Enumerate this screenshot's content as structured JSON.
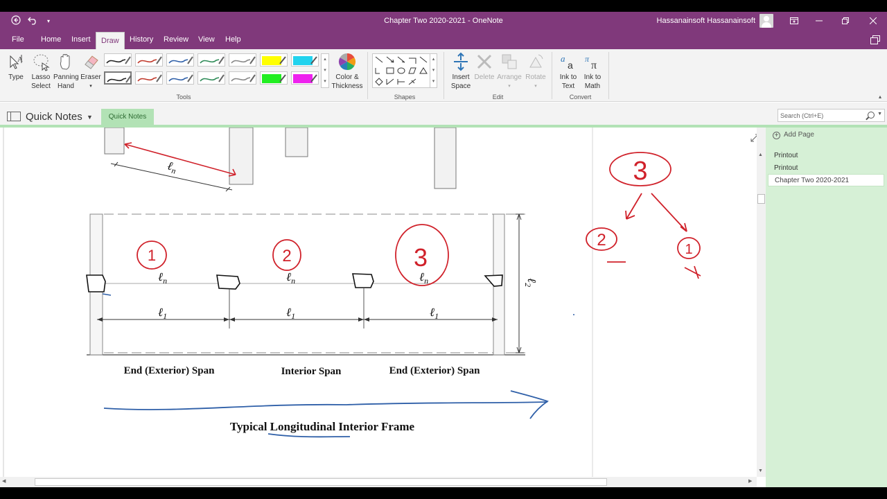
{
  "titlebar": {
    "title": "Chapter Two 2020-2021  -  OneNote",
    "user": "Hassanainsoft Hassanainsoft"
  },
  "menu": [
    "File",
    "Home",
    "Insert",
    "Draw",
    "History",
    "Review",
    "View",
    "Help"
  ],
  "ribbon": {
    "type": "Type",
    "lasso": [
      "Lasso",
      "Select"
    ],
    "panning": [
      "Panning",
      "Hand"
    ],
    "eraser": "Eraser",
    "color": [
      "Color &",
      "Thickness"
    ],
    "insert_space": [
      "Insert",
      "Space"
    ],
    "delete": "Delete",
    "arrange": "Arrange",
    "rotate": "Rotate",
    "ink_text": [
      "Ink to",
      "Text"
    ],
    "ink_math": [
      "Ink to",
      "Math"
    ],
    "groups": {
      "tools": "Tools",
      "shapes": "Shapes",
      "edit": "Edit",
      "convert": "Convert"
    },
    "pen_colors": [
      "#222222",
      "#c0392b",
      "#2e5fa8",
      "#2e8b57",
      "#888888",
      "#ffff00",
      "#22d3ee",
      "#222222",
      "#c0392b",
      "#2e5fa8",
      "#2e8b57",
      "#888888",
      "#22ee22",
      "#ee22ee"
    ]
  },
  "notebook": {
    "name": "Quick Notes",
    "section_tab": "Quick Notes"
  },
  "search": {
    "placeholder": "Search (Ctrl+E)"
  },
  "pages": {
    "add": "Add Page",
    "items": [
      "Printout",
      "Printout",
      "Chapter Two 2020-2021"
    ]
  },
  "drawing": {
    "labels": {
      "ln": "ℓn",
      "l1": "ℓ1",
      "l2": "ℓ2",
      "end_span": "End (Exterior) Span",
      "interior_span": "Interior Span",
      "caption": "Typical Longitudinal Interior Frame"
    },
    "annotations": {
      "circled": [
        "1",
        "2",
        "3"
      ],
      "tree_root": "3",
      "tree_left": "2",
      "tree_right": "1"
    }
  }
}
